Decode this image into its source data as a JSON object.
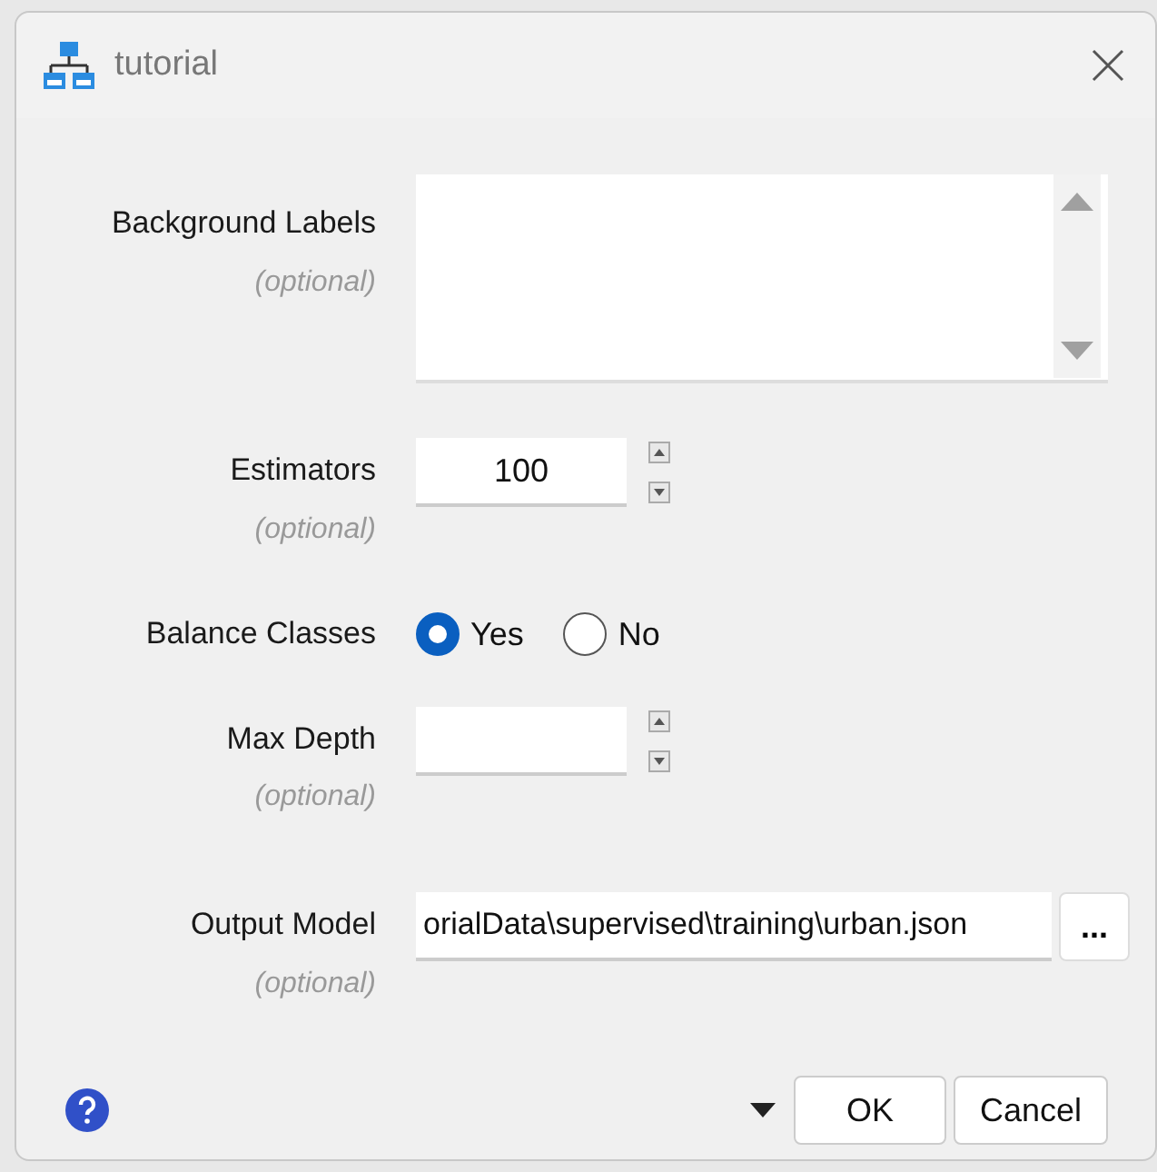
{
  "window": {
    "title": "tutorial"
  },
  "fields": [
    {
      "kind": "textarea",
      "label": "Background Labels",
      "hint": "(optional)"
    },
    {
      "kind": "spinner",
      "label": "Estimators",
      "hint": "(optional)",
      "value": "100"
    },
    {
      "kind": "radio",
      "label": "Balance Classes",
      "options": [
        {
          "label": "Yes",
          "selected": true
        },
        {
          "label": "No",
          "selected": false
        }
      ]
    },
    {
      "kind": "spinner",
      "label": "Max Depth",
      "hint": "(optional)"
    },
    {
      "kind": "file",
      "label": "Output Model",
      "hint": "(optional)",
      "value": "orialData\\supervised\\training\\urban.json",
      "browse": "..."
    }
  ],
  "buttons": [
    "OK",
    "Cancel"
  ]
}
